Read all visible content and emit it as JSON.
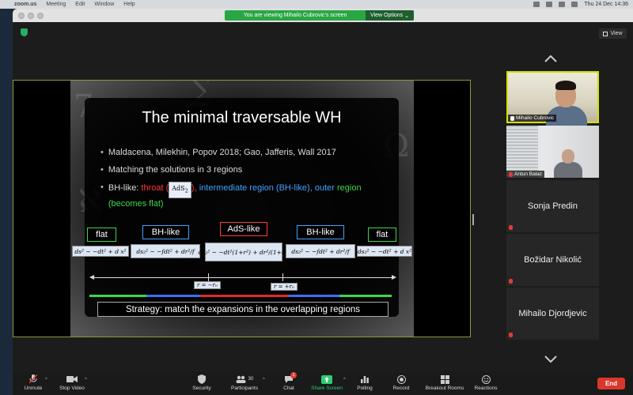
{
  "menubar": {
    "app": "zoom.us",
    "items": [
      "Meeting",
      "Edit",
      "Window",
      "Help"
    ],
    "clock": "Thu 24 Dec  14:36"
  },
  "banner": {
    "message": "You are viewing Mihailo Cubrovic's screen",
    "view_options": "View Options"
  },
  "view_button": "View",
  "slide": {
    "title": "The minimal traversable WH",
    "bullets": [
      "Maldacena, Milekhin, Popov 2018; Gao, Jafferis, Wall 2017",
      "Matching the solutions in 3 regions"
    ],
    "bh_prefix": "BH-like: ",
    "throat": "throat (",
    "ads2": "AdS",
    "ads2_sub": "2",
    "throat_close": "),",
    "intermediate": " intermediate region (BH-like),",
    "outer": " outer region (becomes flat)",
    "labels": {
      "flat_left": "flat",
      "bh_left": "BH-like",
      "ads": "AdS-like",
      "bh_right": "BH-like",
      "flat_right": "flat"
    },
    "eqs": {
      "flat_left": "ds² ~ −dt² + d x²",
      "bh_left": "ds₂² ~ −fdt² + dr²/f",
      "ads": "ds₂² ~ −dt²(1+r²) + dr²/(1+r²)",
      "bh_right": "ds₂² ~ −fdt² + dr²/f",
      "flat_right": "ds₂² ~ −dt² + d x²"
    },
    "r_left": "r = −r₀",
    "r_right": "r = +r₀",
    "strategy": "Strategy: match the expansions in the overlapping regions"
  },
  "participants": [
    {
      "name": "Mihailo Cubrovic",
      "video": true
    },
    {
      "name": "Antun Balaz",
      "video": true
    },
    {
      "name": "Sonja Predin",
      "video": false
    },
    {
      "name": "Božidar Nikolić",
      "video": false
    },
    {
      "name": "Mihailo Djordjevic",
      "video": false
    }
  ],
  "toolbar": {
    "unmute": "Unmute",
    "stop_video": "Stop Video",
    "security": "Security",
    "participants": "Participants",
    "participants_count": "30",
    "chat": "Chat",
    "chat_badge": "1",
    "share": "Share Screen",
    "polling": "Polling",
    "record": "Record",
    "breakout": "Breakout Rooms",
    "reactions": "Reactions",
    "end": "End"
  }
}
